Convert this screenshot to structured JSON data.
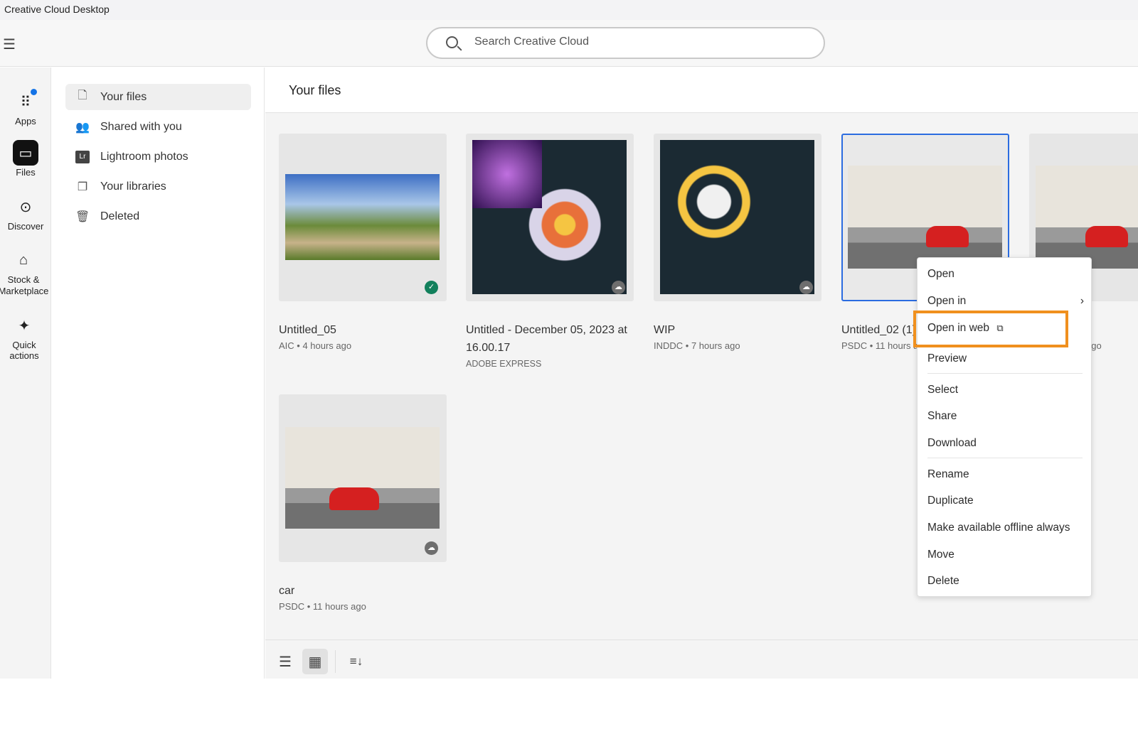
{
  "window": {
    "title": "Creative Cloud Desktop"
  },
  "search": {
    "placeholder": "Search Creative Cloud"
  },
  "rail": [
    {
      "label": "Apps",
      "icon": "apps-grid-icon"
    },
    {
      "label": "Files",
      "icon": "folder-icon"
    },
    {
      "label": "Discover",
      "icon": "compass-icon"
    },
    {
      "label": "Stock & Marketplace",
      "icon": "storefront-icon"
    },
    {
      "label": "Quick actions",
      "icon": "sparkle-icon"
    }
  ],
  "sidebar": {
    "items": [
      {
        "label": "Your files",
        "icon": "file-icon"
      },
      {
        "label": "Shared with you",
        "icon": "people-icon"
      },
      {
        "label": "Lightroom photos",
        "icon": "lightroom-icon"
      },
      {
        "label": "Your libraries",
        "icon": "library-icon"
      },
      {
        "label": "Deleted",
        "icon": "trash-icon"
      }
    ]
  },
  "main": {
    "title": "Your files",
    "files": [
      {
        "name": "Untitled_05",
        "meta": "AIC • 4 hours ago",
        "extra": "",
        "status": "synced"
      },
      {
        "name": "Untitled - December 05, 2023 at 16.00.17",
        "meta": "",
        "extra": "ADOBE EXPRESS",
        "status": "cloud"
      },
      {
        "name": "WIP",
        "meta": "INDDC • 7 hours ago",
        "extra": "",
        "status": "cloud"
      },
      {
        "name": "Untitled_02 (1)",
        "meta": "PSDC • 11 hours ago",
        "extra": "",
        "status": "cloud"
      },
      {
        "name": "",
        "meta": "ago",
        "extra": "",
        "status": "cloud"
      },
      {
        "name": "car",
        "meta": "PSDC • 11 hours ago",
        "extra": "",
        "status": "cloud"
      }
    ]
  },
  "context_menu": {
    "items": [
      "Open",
      "Open in",
      "Open in web",
      "Preview",
      "Select",
      "Share",
      "Download",
      "Rename",
      "Duplicate",
      "Make available offline always",
      "Move",
      "Delete"
    ],
    "highlighted": "Open in web",
    "highlight_color": "#f0901e"
  },
  "colors": {
    "selection": "#2b6ce0",
    "notification": "#1473e6"
  }
}
